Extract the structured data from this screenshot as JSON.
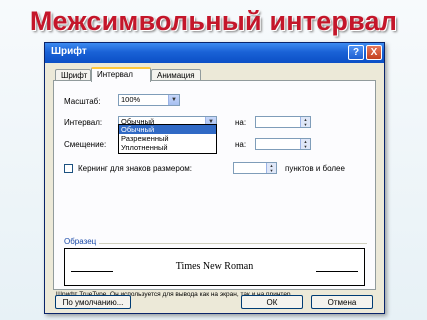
{
  "slide": {
    "title": "Межсимвольный интервал"
  },
  "dialog": {
    "title": "Шрифт",
    "help_label": "?",
    "close_label": "X",
    "tabs": [
      {
        "label": "Шрифт",
        "active": false
      },
      {
        "label": "Интервал",
        "active": true
      },
      {
        "label": "Анимация",
        "active": false
      }
    ],
    "scale": {
      "label": "Масштаб:",
      "value": "100%"
    },
    "interval": {
      "label": "Интервал:",
      "value": "Обычный",
      "by_label": "на:",
      "by_value": "",
      "options": [
        "Обычный",
        "Разреженный",
        "Уплотненный"
      ],
      "selected_index": 0
    },
    "offset": {
      "label": "Смещение:",
      "by_label": "на:",
      "by_value": ""
    },
    "kerning": {
      "label": "Кернинг для знаков размером:",
      "checked": false,
      "size_value": "",
      "suffix": "пунктов и более"
    },
    "sample": {
      "group_label": "Образец",
      "text": "Times New Roman",
      "note": "Шрифт TrueType. Он используется для вывода как на экран, так и на принтер."
    },
    "buttons": {
      "default_label": "По умолчанию...",
      "ok_label": "ОК",
      "cancel_label": "Отмена"
    },
    "colors": {
      "title_red": "#c4162a",
      "titlebar_blue": "#0b4fc6",
      "selection_blue": "#316ac5",
      "group_label_blue": "#1a4aa8"
    },
    "icons": {
      "help": "question-icon",
      "close": "close-icon",
      "dropdown": "chevron-down-icon",
      "spinner": "spin-arrows-icon"
    }
  }
}
